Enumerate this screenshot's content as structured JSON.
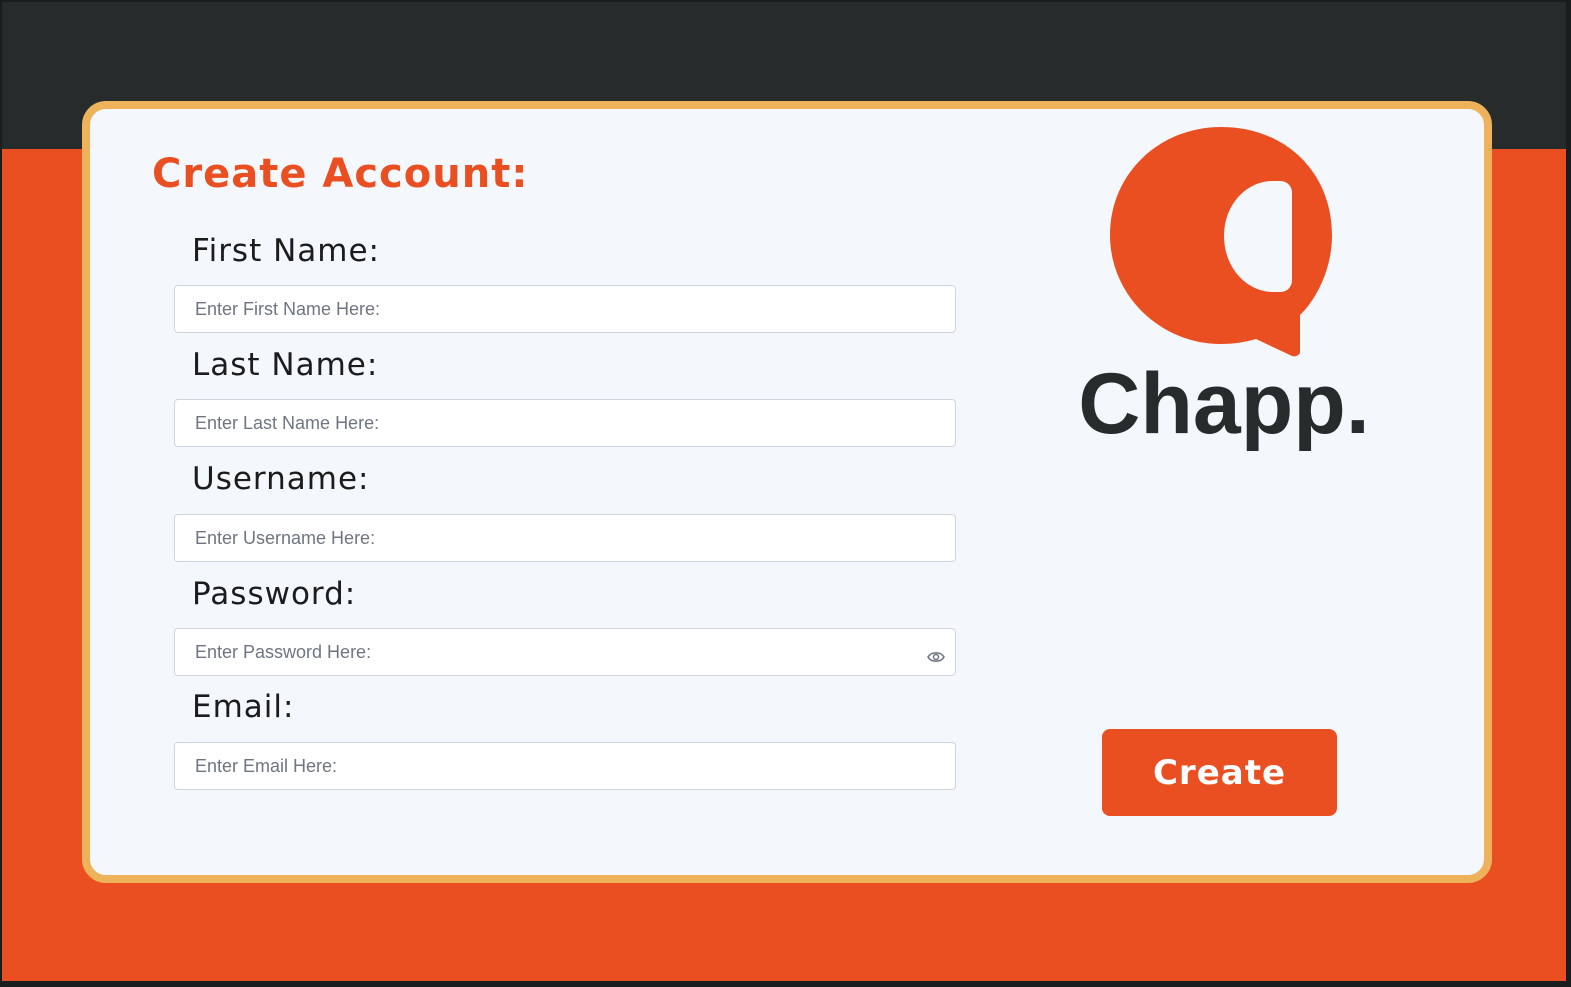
{
  "page": {
    "title": "Create Account:"
  },
  "form": {
    "fields": [
      {
        "label": "First Name:",
        "placeholder": "Enter First Name Here:",
        "value": ""
      },
      {
        "label": "Last Name:",
        "placeholder": "Enter Last Name Here:",
        "value": ""
      },
      {
        "label": "Username:",
        "placeholder": "Enter Username Here:",
        "value": ""
      },
      {
        "label": "Password:",
        "placeholder": "Enter Password Here:",
        "value": "",
        "icon": "eye-icon"
      },
      {
        "label": "Email:",
        "placeholder": "Enter Email Here:",
        "value": ""
      }
    ]
  },
  "brand": {
    "name": "Chapp.",
    "logo_icon": "chat-bubble-logo"
  },
  "actions": {
    "create_label": "Create"
  },
  "colors": {
    "accent": "#ea4f22",
    "dark": "#272b2b",
    "card_border": "#eeb35a",
    "card_bg": "#f4f7fc"
  }
}
